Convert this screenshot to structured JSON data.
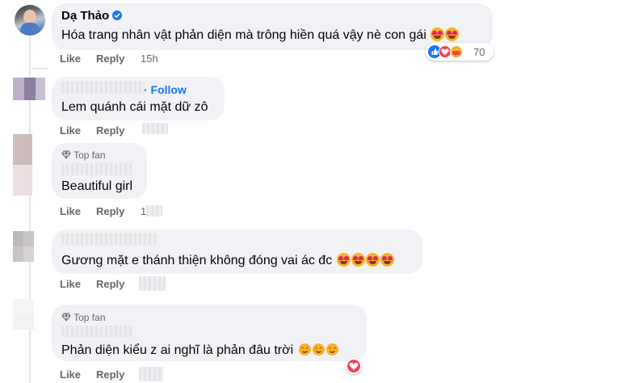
{
  "comments": [
    {
      "author": "Dạ Thảo",
      "verified": true,
      "text": "Hóa trang nhân vật phản diện mà trông hiền quá vậy nè con gái",
      "emoji_count": 2,
      "actions": {
        "like": "Like",
        "reply": "Reply",
        "time": "15h"
      },
      "reactions": {
        "icons": [
          "like-icon",
          "love-icon",
          "care-icon"
        ],
        "count": "70"
      }
    },
    {
      "author_hidden": true,
      "follow": "· Follow",
      "text": "Lem quánh cái mặt dữ zô",
      "actions": {
        "like": "Like",
        "reply": "Reply"
      }
    },
    {
      "badge": "Top fan",
      "author_hidden": true,
      "text": "Beautiful girl",
      "actions": {
        "like": "Like",
        "reply": "Reply",
        "time": "1"
      }
    },
    {
      "author_hidden": true,
      "text": "Gương mặt e thánh thiện không đóng vai ác đc",
      "emoji_count": 4,
      "actions": {
        "like": "Like",
        "reply": "Reply"
      }
    },
    {
      "badge": "Top fan",
      "author_hidden": true,
      "text": "Phản diện kiểu z ai nghĩ là phản đâu trời",
      "emoji_count": 3,
      "actions": {
        "like": "Like",
        "reply": "Reply"
      },
      "reactions": {
        "icons": [
          "love-icon"
        ]
      }
    }
  ],
  "colors": {
    "bubble": "#f0f2f5",
    "link": "#1877f2",
    "meta": "#65676b",
    "verified": "#1877f2",
    "love": "#f33e58"
  }
}
